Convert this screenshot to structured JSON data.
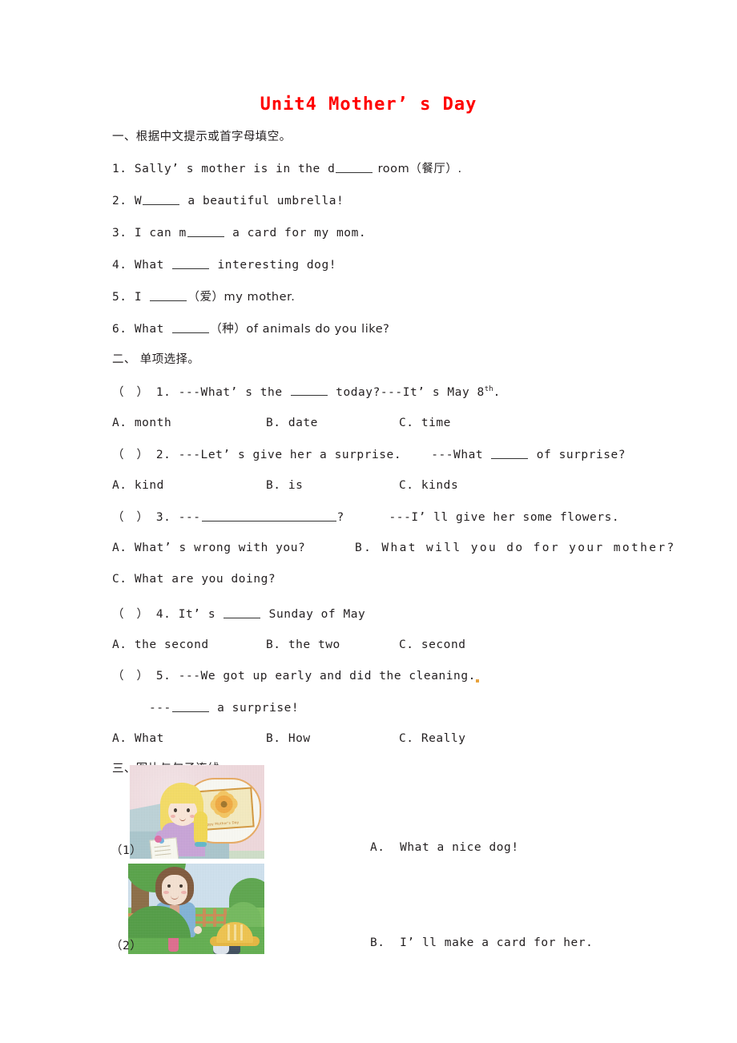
{
  "document": {
    "title": "Unit4 Mother’ s Day",
    "title_color": "#ff0000",
    "background_color": "#ffffff"
  },
  "section1": {
    "heading": "一、根据中文提示或首字母填空。",
    "items": [
      {
        "num": "1.",
        "before": "Sally’ s mother is in the d",
        "after": " room（餐厅）."
      },
      {
        "num": "2.",
        "before": "W",
        "after": " a beautiful umbrella!"
      },
      {
        "num": "3.",
        "before": "I can m",
        "after": " a card for my mom."
      },
      {
        "num": "4.",
        "before": "What ",
        "after": " interesting dog!"
      },
      {
        "num": "5.",
        "before": "I ",
        "after": "（爱）my mother."
      },
      {
        "num": "6.",
        "before": "What ",
        "after": "（种）of animals do you like?"
      }
    ]
  },
  "section2": {
    "heading": "二、 单项选择。",
    "questions": [
      {
        "marker": "（   ）",
        "num": "1.",
        "stem_before": "---What’ s the ",
        "stem_after": " today?---It’ s May 8",
        "stem_sup": "th",
        "stem_tail": ".",
        "options": [
          {
            "key": "A.",
            "text": " month"
          },
          {
            "key": "B.",
            "text": " date"
          },
          {
            "key": "C.",
            "text": " time"
          }
        ]
      },
      {
        "marker": "（   ）",
        "num": "2.",
        "stem_before": "---Let’ s give her a surprise.    ---What ",
        "stem_after": " of surprise?",
        "options": [
          {
            "key": "A.",
            "text": " kind"
          },
          {
            "key": "B.",
            "text": " is"
          },
          {
            "key": "C.",
            "text": " kinds"
          }
        ]
      },
      {
        "marker": "（   ）",
        "num": "3.",
        "stem_before": "---",
        "stem_after": "?      ---I’ ll give her some flowers.",
        "options": [
          {
            "key": "A.",
            "text": " What’ s wrong with you?"
          },
          {
            "key": "B.",
            "text": " What will you do for your mother?"
          },
          {
            "key": "C.",
            "text": " What are you doing?"
          }
        ]
      },
      {
        "marker": "（   ）",
        "num": "4.",
        "stem_before": "It’ s ",
        "stem_after": " Sunday of May",
        "options": [
          {
            "key": "A.",
            "text": " the second"
          },
          {
            "key": "B.",
            "text": " the two"
          },
          {
            "key": "C.",
            "text": " second"
          }
        ]
      },
      {
        "marker": "（   ）",
        "num": "5.",
        "stem_before": "---We got up early and did the cleaning.",
        "stem_line2_before": "---",
        "stem_line2_after": " a surprise!",
        "options": [
          {
            "key": "A.",
            "text": " What"
          },
          {
            "key": "B.",
            "text": " How"
          },
          {
            "key": "C.",
            "text": " Really"
          }
        ]
      }
    ]
  },
  "section3": {
    "heading": "三、图片与句子连线。",
    "pictures": [
      {
        "label": "（1）",
        "alt": "girl-thinking-of-mothers-day-card",
        "card_text": "Happy Mother's Day"
      },
      {
        "label": "（2）",
        "alt": "woman-in-park-with-dog"
      }
    ],
    "options": [
      {
        "key": "A.",
        "text": "  What a nice dog!"
      },
      {
        "key": "B.",
        "text": "  I’ ll make a card for her."
      }
    ]
  }
}
